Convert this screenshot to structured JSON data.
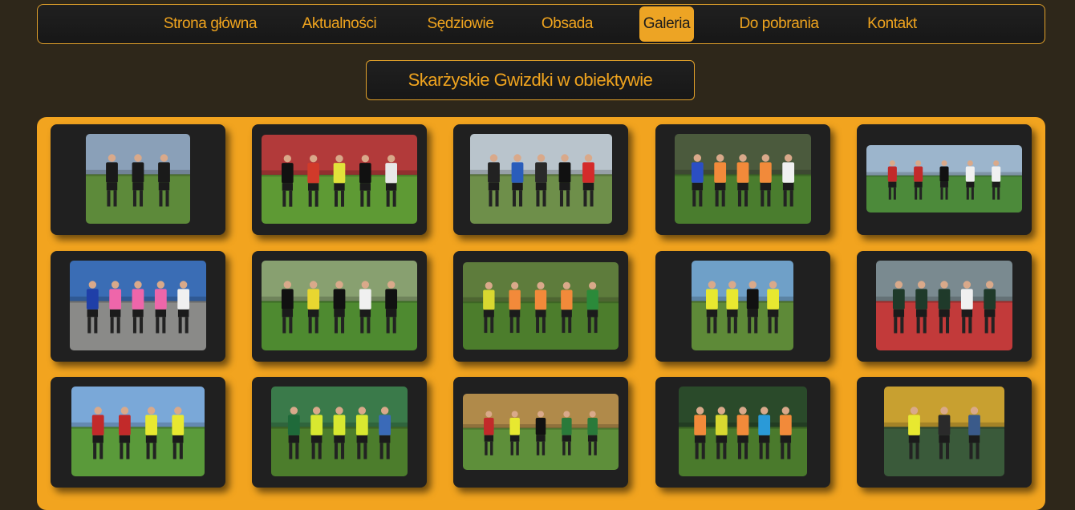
{
  "nav": {
    "items": [
      {
        "label": "Strona główna",
        "active": false
      },
      {
        "label": "Aktualności",
        "active": false
      },
      {
        "label": "Sędziowie",
        "active": false
      },
      {
        "label": "Obsada",
        "active": false
      },
      {
        "label": "Galeria",
        "active": true
      },
      {
        "label": "Do pobrania",
        "active": false
      },
      {
        "label": "Kontakt",
        "active": false
      }
    ]
  },
  "page": {
    "title": "Skarżyskie Gwizdki w obiektywie"
  },
  "gallery": {
    "photos": [
      {
        "name": "gallery-photo-1",
        "sky": "#8aa0b8",
        "ground": "#5d8a3a",
        "kits": [
          "#1a1a1a",
          "#1a1a1a",
          "#1a1a1a"
        ]
      },
      {
        "name": "gallery-photo-2",
        "sky": "#b23a3a",
        "ground": "#5e9a34",
        "kits": [
          "#111111",
          "#d13a2a",
          "#e2e23a",
          "#111111",
          "#e8e8e8"
        ]
      },
      {
        "name": "gallery-photo-3",
        "sky": "#b9c4cc",
        "ground": "#6e8f4a",
        "kits": [
          "#222222",
          "#2a5dbb",
          "#2a2a2a",
          "#111111",
          "#d42a2a"
        ]
      },
      {
        "name": "gallery-photo-4",
        "sky": "#4b5a3d",
        "ground": "#4a7d2e",
        "kits": [
          "#2b4fc4",
          "#f28a3a",
          "#f28a3a",
          "#f28a3a",
          "#f0f0f0"
        ]
      },
      {
        "name": "gallery-photo-5",
        "sky": "#9cb5cc",
        "ground": "#4c8a3a",
        "kits": [
          "#c22a2a",
          "#c22a2a",
          "#111111",
          "#f0f0f0",
          "#f0f0f0"
        ]
      },
      {
        "name": "gallery-photo-6",
        "sky": "#3a6db5",
        "ground": "#8a8a88",
        "kits": [
          "#1f3fa8",
          "#ee66aa",
          "#ee66aa",
          "#ee66aa",
          "#f0f0f0"
        ]
      },
      {
        "name": "gallery-photo-7",
        "sky": "#88a070",
        "ground": "#4e8a30",
        "kits": [
          "#111111",
          "#e8d630",
          "#111111",
          "#f0f0f0",
          "#111111"
        ]
      },
      {
        "name": "gallery-photo-8",
        "sky": "#5e7c3c",
        "ground": "#4c7d2c",
        "kits": [
          "#d8d830",
          "#f28a3a",
          "#f28a3a",
          "#f28a3a",
          "#2b8a3a"
        ]
      },
      {
        "name": "gallery-photo-9",
        "sky": "#6fa0c8",
        "ground": "#5e8a38",
        "kits": [
          "#e8e830",
          "#e8e830",
          "#111111",
          "#e8e830"
        ]
      },
      {
        "name": "gallery-photo-10",
        "sky": "#7a8a90",
        "ground": "#c23a3a",
        "kits": [
          "#1f3a2a",
          "#1f3a2a",
          "#1f3a2a",
          "#f0f0f0",
          "#1f3a2a"
        ]
      },
      {
        "name": "gallery-photo-11",
        "sky": "#7aa8d8",
        "ground": "#5a9a3a",
        "kits": [
          "#c22a2a",
          "#c22a2a",
          "#e8e830",
          "#e8e830"
        ]
      },
      {
        "name": "gallery-photo-12",
        "sky": "#3a7a4a",
        "ground": "#4c7d2c",
        "kits": [
          "#1f6a3a",
          "#d8e830",
          "#d8e830",
          "#d8e830",
          "#3a6ab8"
        ]
      },
      {
        "name": "gallery-photo-13",
        "sky": "#b08a4a",
        "ground": "#5e8f3a",
        "kits": [
          "#c22a2a",
          "#e8e830",
          "#111111",
          "#2a7a3a",
          "#2a7a3a"
        ]
      },
      {
        "name": "gallery-photo-14",
        "sky": "#2a4a2a",
        "ground": "#4a7a2c",
        "kits": [
          "#f28a3a",
          "#d8d830",
          "#f28a3a",
          "#2a9ad8",
          "#f28a3a"
        ]
      },
      {
        "name": "gallery-photo-15",
        "sky": "#c8a030",
        "ground": "#3a5a3a",
        "kits": [
          "#e8e830",
          "#2a2a2a",
          "#3a5a8a"
        ]
      }
    ]
  }
}
